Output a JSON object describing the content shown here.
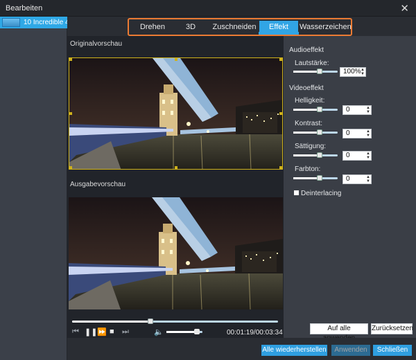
{
  "window": {
    "title": "Bearbeiten"
  },
  "sidebar": {
    "items": [
      {
        "label": "10 Incredible 4"
      }
    ]
  },
  "tabs": [
    {
      "label": "Drehen"
    },
    {
      "label": "3D"
    },
    {
      "label": "Zuschneiden"
    },
    {
      "label": "Effekt",
      "active": true
    },
    {
      "label": "Wasserzeichen"
    }
  ],
  "preview": {
    "original_label": "Originalvorschau",
    "output_label": "Ausgabevorschau"
  },
  "player": {
    "timecode": "00:01:19/00:03:34",
    "progress": 0.38,
    "volume": 0.85
  },
  "audio": {
    "section": "Audioeffekt",
    "volume_label": "Lautstärke:",
    "volume_value": "100%"
  },
  "video": {
    "section": "Videoeffekt",
    "brightness_label": "Helligkeit:",
    "brightness_value": "0",
    "contrast_label": "Kontrast:",
    "contrast_value": "0",
    "saturation_label": "Sättigung:",
    "saturation_value": "0",
    "hue_label": "Farbton:",
    "hue_value": "0",
    "deinterlacing_label": "Deinterlacing"
  },
  "buttons": {
    "apply_all": "Auf alle anwenden",
    "reset": "Zurücksetzen",
    "restore_all": "Alle wiederherstellen",
    "apply": "Anwenden",
    "close": "Schließen"
  },
  "icons": {
    "close": "close-icon",
    "prev": "skip-back-icon",
    "play": "pause-icon",
    "fast_forward": "fast-forward-icon",
    "stop": "stop-icon",
    "next": "skip-forward-icon",
    "volume": "speaker-icon"
  },
  "colors": {
    "accent": "#31a5e5",
    "tab_highlight": "#ec7b33",
    "crop_frame": "#cfb21b"
  }
}
